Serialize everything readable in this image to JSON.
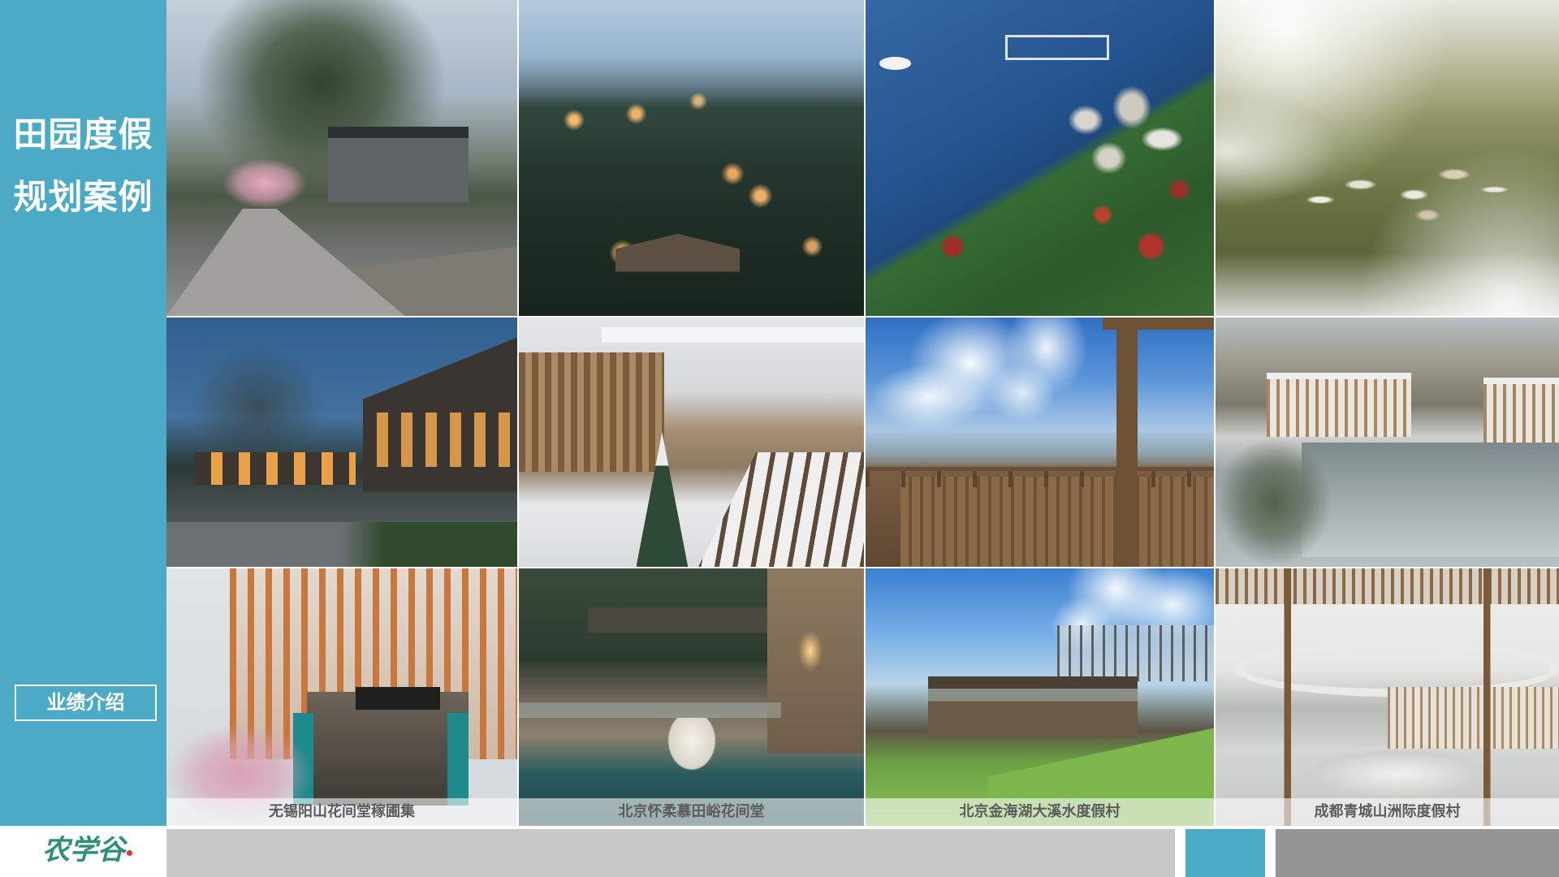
{
  "theme": {
    "accent": "#4BAAC6",
    "footer_gray": "#C8C8C8",
    "footer_dark": "#959595"
  },
  "sidebar": {
    "title_line1": "田园度假",
    "title_line2": "规划案例",
    "nav_button": "业绩介绍"
  },
  "captions": [
    "无锡阳山花间堂稼圃集",
    "北京怀柔慕田峪花间堂",
    "北京金海湖大溪水度假村",
    "成都青城山洲际度假村"
  ],
  "footer": {
    "logo_text": "农学谷"
  }
}
